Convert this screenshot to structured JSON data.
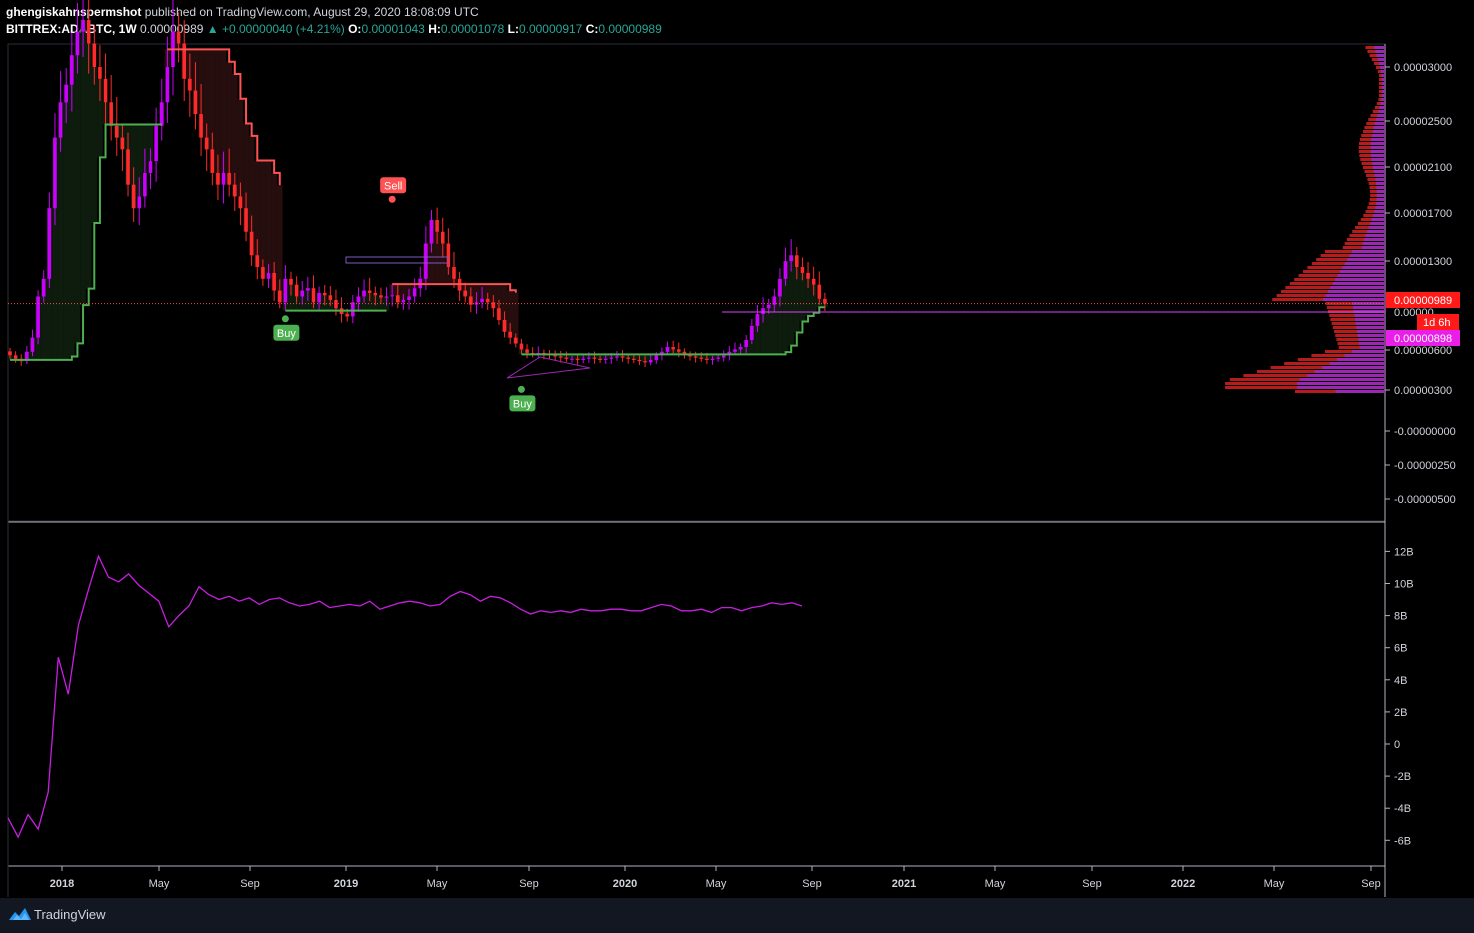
{
  "header": {
    "author": "ghengiskahnspermshot",
    "published_text": "published on TradingView.com, August 29, 2020 18:08:09 UTC",
    "symbol": "BITTREX:ADABTC, 1W",
    "last": "0.00000989",
    "change": "▲ +0.00000040 (+4.21%)",
    "o_label": "O:",
    "o_val": "0.00001043",
    "h_label": "H:",
    "h_val": "0.00001078",
    "l_label": "L:",
    "l_val": "0.00000917",
    "c_label": "C:",
    "c_val": "0.00000989"
  },
  "footer": {
    "brand": "TradingView"
  },
  "colors": {
    "bull": "#cc00ff",
    "bear": "#ff2a2a",
    "stop_long": "#4caf50",
    "stop_short": "#ff5252",
    "vp_red": "#b71c1c",
    "vp_purple": "#9c27b0",
    "osc": "#c71ee0",
    "poc": "#e040fb"
  },
  "chart_data": [
    {
      "type": "candlestick",
      "name": "BITTREX:ADABTC, 1W",
      "x_ticks": [
        "2018",
        "May",
        "Sep",
        "2019",
        "May",
        "Sep",
        "2020",
        "May",
        "Sep",
        "2021",
        "May",
        "Sep",
        "2022",
        "May",
        "Sep"
      ],
      "y_ticks": [
        "0.00003000",
        "0.00002500",
        "0.00002100",
        "0.00001700",
        "0.00001300",
        "0.00000600",
        "0.00000300",
        "-0.00000000",
        "-0.00000250",
        "-0.00000500"
      ],
      "price_labels": [
        {
          "text": "0.00000989",
          "color": "#ff1a1a"
        },
        {
          "text": "0.00000",
          "color": "#000000"
        },
        {
          "text": "1d 6h",
          "color": "#ff1a1a"
        },
        {
          "text": "0.00000898",
          "color": "#e91ee8"
        }
      ],
      "weekly_close": [
        5.5e-06,
        5.2e-06,
        5e-06,
        5.8e-06,
        7e-06,
        1.05e-05,
        1.2e-05,
        1.8e-05,
        2.4e-05,
        2.7e-05,
        2.85e-05,
        3.1e-05,
        3.3e-05,
        3.4e-05,
        3.2e-05,
        3e-05,
        2.9e-05,
        2.7e-05,
        2.5e-05,
        2.4e-05,
        2.3e-05,
        2e-05,
        1.8e-05,
        1.9e-05,
        2.1e-05,
        2.2e-05,
        2.5e-05,
        2.7e-05,
        3e-05,
        3.3e-05,
        3.2e-05,
        2.9e-05,
        2.8e-05,
        2.6e-05,
        2.4e-05,
        2.3e-05,
        2.1e-05,
        2e-05,
        2.1e-05,
        2e-05,
        1.9e-05,
        1.8e-05,
        1.6e-05,
        1.4e-05,
        1.3e-05,
        1.2e-05,
        1.25e-05,
        1.1e-05,
        1e-05,
        1.2e-05,
        1.15e-05,
        1.05e-05,
        1.1e-05,
        1.12e-05,
        1e-05,
        1.08e-05,
        1.06e-05,
        1.02e-05,
        9.5e-06,
        9e-06,
        8.8e-06,
        1e-05,
        1.05e-05,
        1.1e-05,
        1.08e-05,
        1.06e-05,
        1.04e-05,
        1.05e-05,
        1.06e-05,
        1e-05,
        1.02e-05,
        1.05e-05,
        1.12e-05,
        1.2e-05,
        1.5e-05,
        1.7e-05,
        1.6e-05,
        1.5e-05,
        1.3e-05,
        1.2e-05,
        1.1e-05,
        1.05e-05,
        9.8e-06,
        1e-05,
        1.03e-05,
        1e-05,
        9.5e-06,
        8.5e-06,
        7.5e-06,
        7e-06,
        6.5e-06,
        6e-06,
        5.7e-06,
        5.6e-06,
        5.7e-06,
        5.6e-06,
        5.5e-06,
        5.4e-06,
        5.3e-06,
        5.2e-06,
        5.2e-06,
        5.1e-06,
        5.2e-06,
        5.3e-06,
        5.2e-06,
        5.1e-06,
        5.2e-06,
        5.3e-06,
        5.4e-06,
        5.3e-06,
        5.2e-06,
        5.1e-06,
        5e-06,
        4.9e-06,
        5.1e-06,
        5.5e-06,
        5.8e-06,
        6.2e-06,
        6e-06,
        5.8e-06,
        5.5e-06,
        5.4e-06,
        5.3e-06,
        5.2e-06,
        5.1e-06,
        5.2e-06,
        5.3e-06,
        5.5e-06,
        5.8e-06,
        6e-06,
        6.2e-06,
        6.8e-06,
        8e-06,
        9e-06,
        9.5e-06,
        9.8e-06,
        1.05e-05,
        1.2e-05,
        1.35e-05,
        1.4e-05,
        1.3e-05,
        1.25e-05,
        1.2e-05,
        1.15e-05,
        1.03e-05,
        9.9e-06
      ],
      "signals": [
        {
          "label": "Sell",
          "week": 28
        },
        {
          "label": "Buy",
          "week": 49
        },
        {
          "label": "Sell",
          "week": 68
        },
        {
          "label": "Buy",
          "week": 91
        }
      ],
      "volume_profile_note": "horizontal red/purple histogram on right edge"
    },
    {
      "type": "line",
      "name": "oscillator",
      "y_ticks": [
        "12B",
        "10B",
        "8B",
        "6B",
        "4B",
        "2B",
        "0",
        "-2B",
        "-4B",
        "-6B"
      ],
      "ylim": [
        -7,
        13
      ],
      "values": [
        -4.6,
        -5.8,
        -4.4,
        -5.3,
        -3.0,
        5.4,
        3.1,
        7.4,
        9.6,
        11.7,
        10.4,
        10.1,
        10.6,
        9.9,
        9.4,
        8.9,
        7.3,
        8.0,
        8.6,
        9.8,
        9.3,
        9.0,
        9.2,
        8.9,
        9.1,
        8.7,
        9.0,
        9.1,
        8.8,
        8.6,
        8.7,
        8.9,
        8.5,
        8.6,
        8.7,
        8.6,
        8.9,
        8.4,
        8.6,
        8.8,
        8.9,
        8.8,
        8.6,
        8.7,
        9.2,
        9.5,
        9.3,
        8.9,
        9.2,
        9.1,
        8.8,
        8.4,
        8.1,
        8.3,
        8.2,
        8.3,
        8.2,
        8.4,
        8.3,
        8.3,
        8.4,
        8.4,
        8.3,
        8.3,
        8.5,
        8.7,
        8.6,
        8.3,
        8.3,
        8.4,
        8.2,
        8.5,
        8.5,
        8.3,
        8.5,
        8.6,
        8.8,
        8.7,
        8.8,
        8.6
      ]
    }
  ]
}
